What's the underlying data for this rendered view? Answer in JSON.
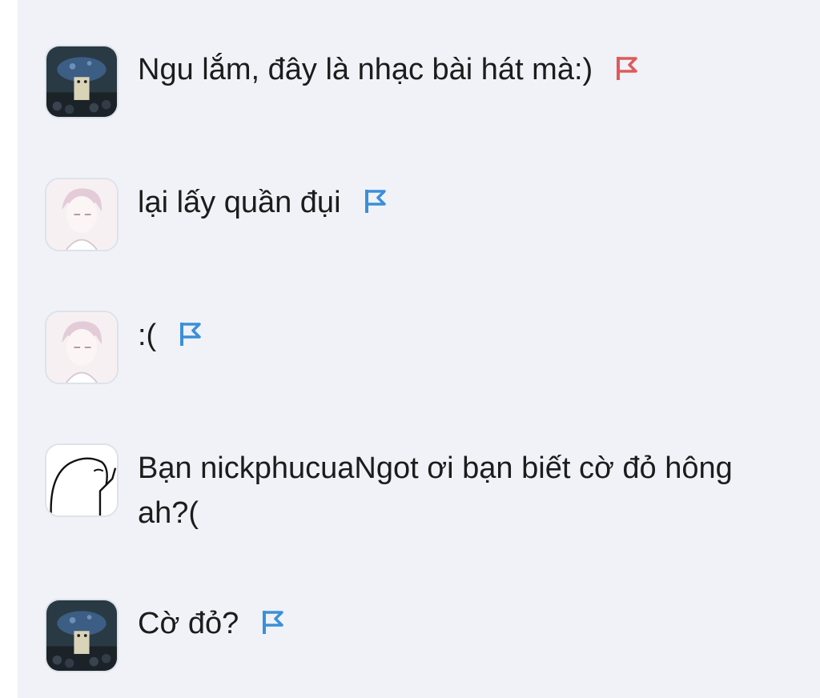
{
  "comments": [
    {
      "avatar": "mushroom-avatar",
      "text": "Ngu lắm, đây là nhạc bài hát mà:)",
      "flag_color": "#e05a5a",
      "flag_icon": "report-flag-icon"
    },
    {
      "avatar": "anime-boy-avatar",
      "text": "lại lấy quần đụi",
      "flag_color": "#3b8fd9",
      "flag_icon": "report-flag-icon"
    },
    {
      "avatar": "anime-boy-avatar",
      "text": ":(",
      "flag_color": "#3b8fd9",
      "flag_icon": "report-flag-icon"
    },
    {
      "avatar": "doodle-avatar",
      "text": "Bạn nickphucuaNgot ơi bạn biết cờ đỏ hông ah?(",
      "flag_color": null,
      "flag_icon": null
    },
    {
      "avatar": "mushroom-avatar",
      "text": "Cờ đỏ?",
      "flag_color": "#3b8fd9",
      "flag_icon": "report-flag-icon"
    }
  ]
}
